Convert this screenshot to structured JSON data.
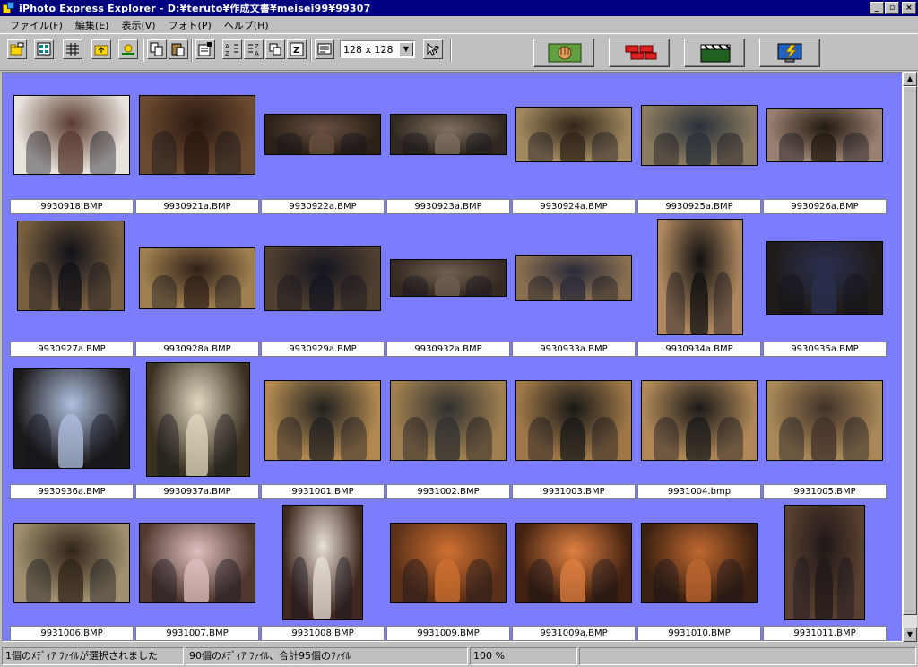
{
  "window": {
    "title": "iPhoto Express Explorer - D:¥teruto¥作成文書¥meisei99¥99307",
    "btn_min": "_",
    "btn_restore": "▫",
    "btn_close": "×"
  },
  "menu": [
    "ファイル(F)",
    "編集(E)",
    "表示(V)",
    "フォト(P)",
    "ヘルプ(H)"
  ],
  "toolbar": {
    "thumb_size": "128 x 128"
  },
  "photos": [
    {
      "name": "9930918.BMP",
      "colors": [
        "#e8e4dc",
        "#5a3a30"
      ]
    },
    {
      "name": "9930921a.BMP",
      "colors": [
        "#6a4a30",
        "#2a1810"
      ]
    },
    {
      "name": "9930922a.BMP",
      "colors": [
        "#2a2018",
        "#6a5040"
      ]
    },
    {
      "name": "9930923a.BMP",
      "colors": [
        "#302820",
        "#807060"
      ]
    },
    {
      "name": "9930924a.BMP",
      "colors": [
        "#a08860",
        "#302418"
      ]
    },
    {
      "name": "9930925a.BMP",
      "colors": [
        "#8a7a60",
        "#28303a"
      ]
    },
    {
      "name": "9930926a.BMP",
      "colors": [
        "#9a8070",
        "#201810"
      ]
    },
    {
      "name": "9930927a.BMP",
      "colors": [
        "#7a6040",
        "#101018"
      ]
    },
    {
      "name": "9930928a.BMP",
      "colors": [
        "#a08050",
        "#302018"
      ]
    },
    {
      "name": "9930929a.BMP",
      "colors": [
        "#504030",
        "#151520"
      ]
    },
    {
      "name": "9930932a.BMP",
      "colors": [
        "#352a22",
        "#706050"
      ]
    },
    {
      "name": "9930933a.BMP",
      "colors": [
        "#8a7050",
        "#2a2a3a"
      ]
    },
    {
      "name": "9930934a.BMP",
      "colors": [
        "#b08860",
        "#101010"
      ]
    },
    {
      "name": "9930935a.BMP",
      "colors": [
        "#201a18",
        "#2a3050"
      ]
    },
    {
      "name": "9930936a.BMP",
      "colors": [
        "#1a1818",
        "#b0c0e0"
      ]
    },
    {
      "name": "9930937a.BMP",
      "colors": [
        "#3a3020",
        "#e0d8c0"
      ]
    },
    {
      "name": "9931001.BMP",
      "colors": [
        "#b08850",
        "#202020"
      ]
    },
    {
      "name": "9931002.BMP",
      "colors": [
        "#a08050",
        "#303030"
      ]
    },
    {
      "name": "9931003.BMP",
      "colors": [
        "#a07848",
        "#181818"
      ]
    },
    {
      "name": "9931004.bmp",
      "colors": [
        "#b08858",
        "#1a1a1a"
      ]
    },
    {
      "name": "9931005.BMP",
      "colors": [
        "#a88858",
        "#403028"
      ]
    },
    {
      "name": "9931006.BMP",
      "colors": [
        "#a09070",
        "#302418"
      ]
    },
    {
      "name": "9931007.BMP",
      "colors": [
        "#503830",
        "#e0c0c0"
      ]
    },
    {
      "name": "9931008.BMP",
      "colors": [
        "#402820",
        "#e8e0d8"
      ]
    },
    {
      "name": "9931009.BMP",
      "colors": [
        "#5a3018",
        "#d07030"
      ]
    },
    {
      "name": "9931009a.BMP",
      "colors": [
        "#402010",
        "#e08040"
      ]
    },
    {
      "name": "9931010.BMP",
      "colors": [
        "#3a2010",
        "#c06830"
      ]
    },
    {
      "name": "9931011.BMP",
      "colors": [
        "#5a4030",
        "#201818"
      ]
    }
  ],
  "status": {
    "selection": "1個のﾒﾃﾞｨｱ ﾌｧｲﾙが選択されました",
    "count": "90個のﾒﾃﾞｨｱ ﾌｧｲﾙ、合計95個のﾌｧｲﾙ",
    "zoom": "100 %"
  }
}
